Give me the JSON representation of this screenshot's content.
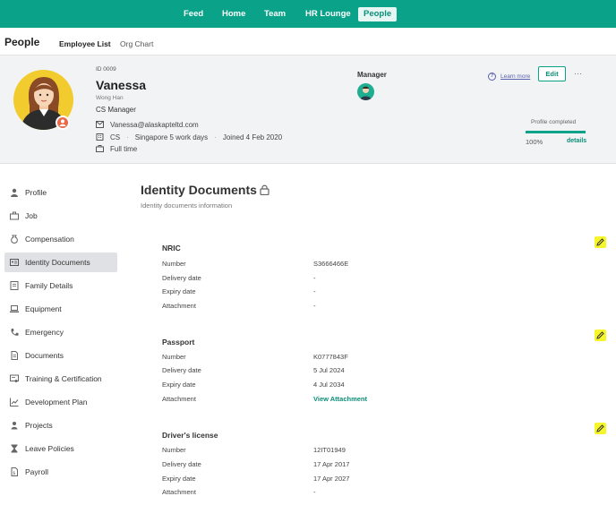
{
  "topnav": {
    "items": [
      "Feed",
      "Home",
      "Team",
      "HR Lounge",
      "People"
    ],
    "active": "People"
  },
  "subheader": {
    "title": "People",
    "tabs": [
      "Employee List",
      "Org Chart"
    ]
  },
  "profile": {
    "id": "ID 0009",
    "name": "Vanessa",
    "subname": "Wong Han",
    "position": "CS Manager",
    "email": "Vanessa@alaskapteltd.com",
    "department": "CS",
    "schedule": "Singapore 5 work days",
    "joined": "Joined 4 Feb 2020",
    "employment": "Full time",
    "manager_label": "Manager",
    "learn_more": "Learn more",
    "edit_label": "Edit",
    "more_label": "···",
    "completed_label": "Profile completed",
    "completed_pct": "100%",
    "completed_value": 1.0,
    "details_label": "details",
    "accent": "#0aa389"
  },
  "sidebar": {
    "items": [
      {
        "label": "Profile",
        "icon": "person-icon"
      },
      {
        "label": "Job",
        "icon": "briefcase-icon"
      },
      {
        "label": "Compensation",
        "icon": "money-bag-icon"
      },
      {
        "label": "Identity Documents",
        "icon": "id-card-icon"
      },
      {
        "label": "Family Details",
        "icon": "family-icon"
      },
      {
        "label": "Equipment",
        "icon": "laptop-icon"
      },
      {
        "label": "Emergency",
        "icon": "phone-icon"
      },
      {
        "label": "Documents",
        "icon": "document-icon"
      },
      {
        "label": "Training & Certification",
        "icon": "certificate-icon"
      },
      {
        "label": "Development Plan",
        "icon": "chart-icon"
      },
      {
        "label": "Projects",
        "icon": "project-icon"
      },
      {
        "label": "Leave Policies",
        "icon": "hourglass-icon"
      },
      {
        "label": "Payroll",
        "icon": "payroll-icon"
      }
    ],
    "active": "Identity Documents"
  },
  "main": {
    "title": "Identity Documents",
    "subtitle": "Identity documents information",
    "documents": [
      {
        "title": "NRIC",
        "fields": [
          {
            "label": "Number",
            "value": "S3666466E"
          },
          {
            "label": "Delivery date",
            "value": "-"
          },
          {
            "label": "Expiry date",
            "value": "-"
          },
          {
            "label": "Attachment",
            "value": "-"
          }
        ]
      },
      {
        "title": "Passport",
        "fields": [
          {
            "label": "Number",
            "value": "K0777843F"
          },
          {
            "label": "Delivery date",
            "value": "5 Jul 2024"
          },
          {
            "label": "Expiry date",
            "value": "4 Jul 2034"
          },
          {
            "label": "Attachment",
            "value": "View Attachment"
          }
        ]
      },
      {
        "title": "Driver's license",
        "fields": [
          {
            "label": "Number",
            "value": "12IT01949"
          },
          {
            "label": "Delivery date",
            "value": "17 Apr 2017"
          },
          {
            "label": "Expiry date",
            "value": "17 Apr 2027"
          },
          {
            "label": "Attachment",
            "value": "-"
          }
        ]
      }
    ]
  }
}
